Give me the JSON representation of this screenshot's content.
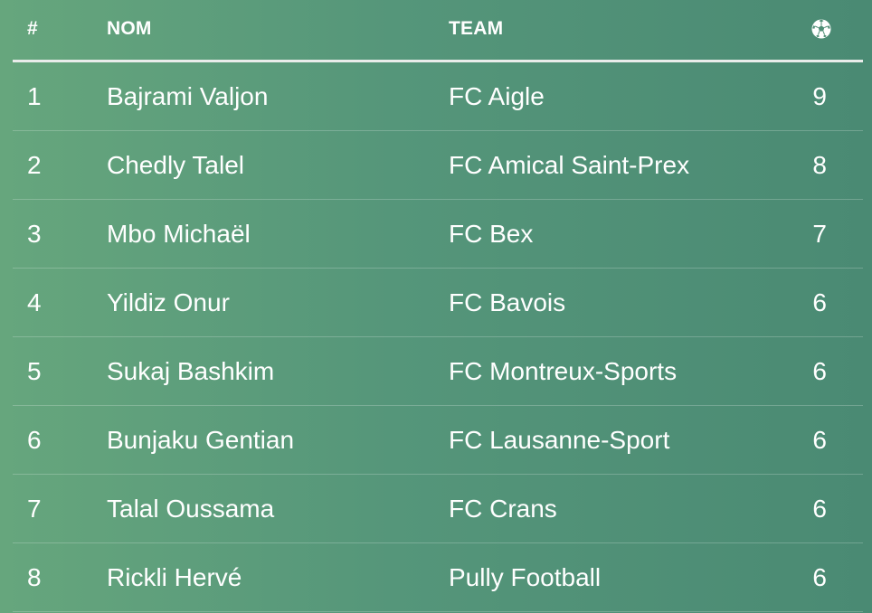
{
  "table": {
    "headers": {
      "rank": "#",
      "name": "NOM",
      "team": "TEAM",
      "goals_icon": "soccer-ball-icon"
    },
    "rows": [
      {
        "rank": "1",
        "name": "Bajrami Valjon",
        "team": "FC Aigle",
        "goals": "9"
      },
      {
        "rank": "2",
        "name": "Chedly Talel",
        "team": "FC Amical Saint-Prex",
        "goals": "8"
      },
      {
        "rank": "3",
        "name": "Mbo Michaël",
        "team": "FC Bex",
        "goals": "7"
      },
      {
        "rank": "4",
        "name": "Yildiz Onur",
        "team": "FC Bavois",
        "goals": "6"
      },
      {
        "rank": "5",
        "name": "Sukaj Bashkim",
        "team": "FC Montreux-Sports",
        "goals": "6"
      },
      {
        "rank": "6",
        "name": "Bunjaku Gentian",
        "team": "FC Lausanne-Sport",
        "goals": "6"
      },
      {
        "rank": "7",
        "name": "Talal Oussama",
        "team": "FC Crans",
        "goals": "6"
      },
      {
        "rank": "8",
        "name": "Rickli Hervé",
        "team": "Pully Football",
        "goals": "6"
      }
    ]
  },
  "colors": {
    "background_start": "#66a67d",
    "background_end": "#4a8a73",
    "text": "#ffffff",
    "header_divider": "#e9ecea"
  }
}
